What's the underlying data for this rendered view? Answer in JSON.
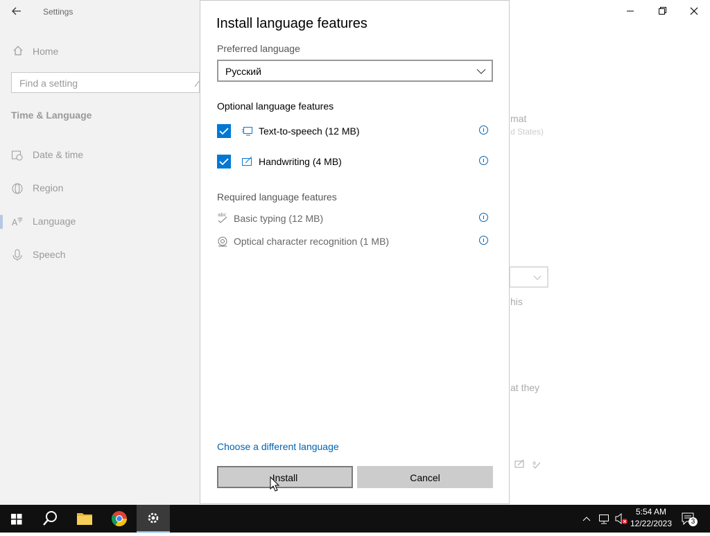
{
  "settings_window": {
    "title": "Settings",
    "home_label": "Home",
    "search_placeholder": "Find a setting",
    "section_title": "Time & Language",
    "nav_items": [
      {
        "label": "Date & time",
        "icon": "calendar-clock-icon"
      },
      {
        "label": "Region",
        "icon": "globe-icon"
      },
      {
        "label": "Language",
        "icon": "language-icon"
      },
      {
        "label": "Speech",
        "icon": "microphone-icon"
      }
    ],
    "selected_nav": "Language",
    "background_fragments": [
      "mat",
      "d States)",
      "his",
      "at they"
    ]
  },
  "dialog": {
    "title": "Install language features",
    "preferred_language_label": "Preferred language",
    "preferred_language_value": "Русский",
    "optional_header": "Optional language features",
    "optional_features": [
      {
        "label": "Text-to-speech (12 MB)",
        "checked": true,
        "icon": "speech-icon"
      },
      {
        "label": "Handwriting (4 MB)",
        "checked": true,
        "icon": "handwriting-icon"
      }
    ],
    "required_header": "Required language features",
    "required_features": [
      {
        "label": "Basic typing (12 MB)",
        "icon": "abc-typing-icon"
      },
      {
        "label": "Optical character recognition (1 MB)",
        "icon": "ocr-icon"
      }
    ],
    "change_link": "Choose a different language",
    "install_label": "Install",
    "cancel_label": "Cancel"
  },
  "taskbar": {
    "time": "5:54 AM",
    "date": "12/22/2023",
    "notification_count": "3"
  },
  "colors": {
    "accent": "#0078d4",
    "link": "#0063b1",
    "sidebar_bg": "#f2f2f2",
    "taskbar_bg": "#101010",
    "button_bg": "#cccccc"
  }
}
